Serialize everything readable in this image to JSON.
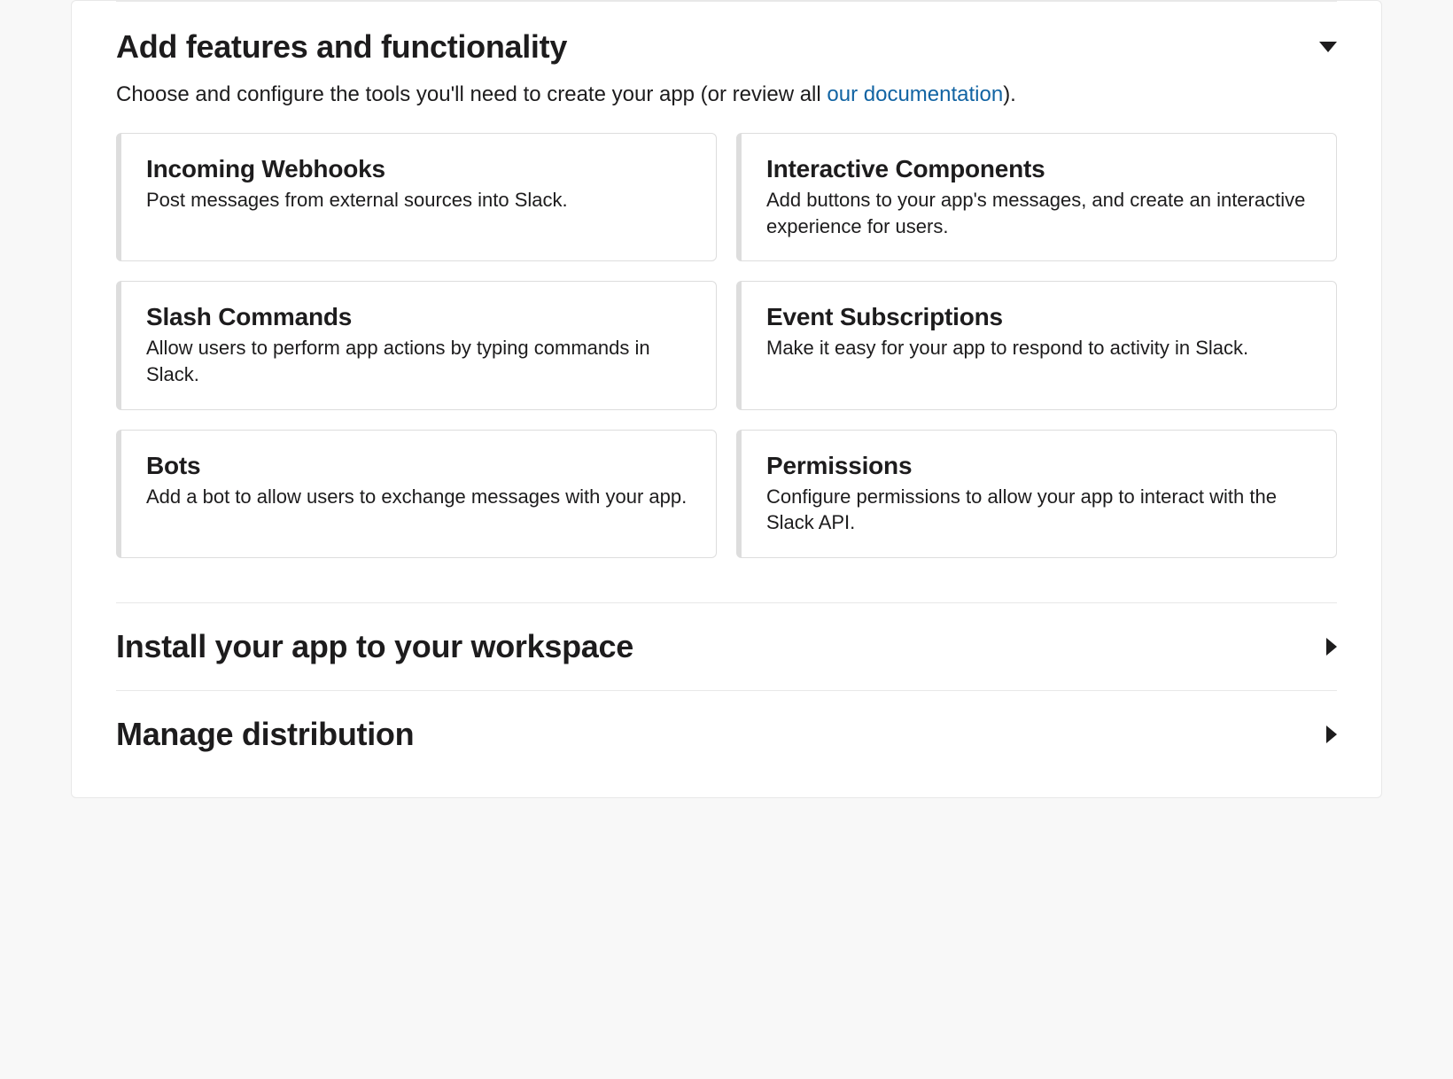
{
  "sections": {
    "features": {
      "title": "Add features and functionality",
      "subtitle_pre": "Choose and configure the tools you'll need to create your app (or review all ",
      "subtitle_link": "our documentation",
      "subtitle_post": ").",
      "cards": [
        {
          "title": "Incoming Webhooks",
          "desc": "Post messages from external sources into Slack."
        },
        {
          "title": "Interactive Components",
          "desc": "Add buttons to your app's messages, and create an interactive experience for users."
        },
        {
          "title": "Slash Commands",
          "desc": "Allow users to perform app actions by typing commands in Slack."
        },
        {
          "title": "Event Subscriptions",
          "desc": "Make it easy for your app to respond to activity in Slack."
        },
        {
          "title": "Bots",
          "desc": "Add a bot to allow users to exchange messages with your app."
        },
        {
          "title": "Permissions",
          "desc": "Configure permissions to allow your app to interact with the Slack API."
        }
      ]
    },
    "install": {
      "title": "Install your app to your workspace"
    },
    "distribution": {
      "title": "Manage distribution"
    }
  }
}
